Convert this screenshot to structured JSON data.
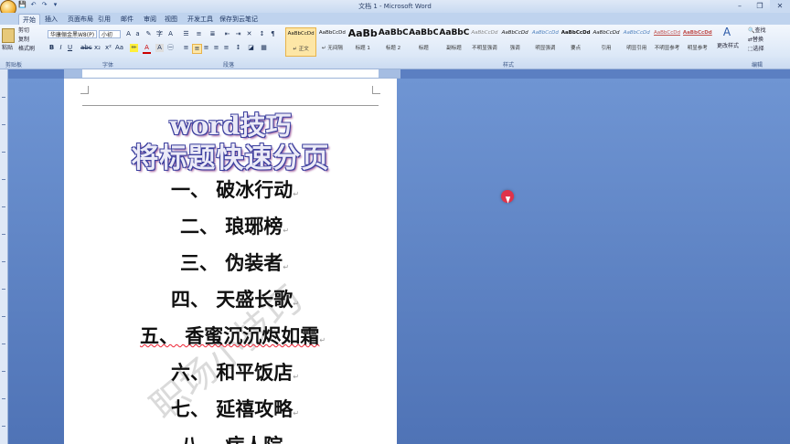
{
  "window": {
    "title": "文档 1 - Microsoft Word",
    "minimize": "–",
    "restore": "❐",
    "close": "✕"
  },
  "qat": [
    "💾",
    "↶",
    "↷",
    "▾"
  ],
  "tabs": [
    "开始",
    "插入",
    "页面布局",
    "引用",
    "邮件",
    "审阅",
    "视图",
    "开发工具",
    "保存到云笔记"
  ],
  "ribbon": {
    "clipboard": {
      "paste": "粘贴",
      "cut": "剪切",
      "copy": "复制",
      "format_painter": "格式刷",
      "label": "剪贴板"
    },
    "font": {
      "name": "华康俪金黑W8(P)",
      "size": "小初",
      "label": "字体"
    },
    "paragraph": {
      "label": "段落"
    },
    "styles": {
      "label": "样式",
      "items": [
        {
          "preview": "AaBbCcDd",
          "name": "↵ 正文"
        },
        {
          "preview": "AaBbCcDd",
          "name": "↵ 无间隔"
        },
        {
          "preview": "AaBb",
          "name": "标题 1"
        },
        {
          "preview": "AaBbC",
          "name": "标题 2"
        },
        {
          "preview": "AaBbC",
          "name": "标题"
        },
        {
          "preview": "AaBbC",
          "name": "副标题"
        },
        {
          "preview": "AaBbCcDd",
          "name": "不明显强调"
        },
        {
          "preview": "AaBbCcDd",
          "name": "强调"
        },
        {
          "preview": "AaBbCcDd",
          "name": "明显强调"
        },
        {
          "preview": "AaBbCcDd",
          "name": "要点"
        },
        {
          "preview": "AaBbCcDd",
          "name": "引用"
        },
        {
          "preview": "AaBbCcDd",
          "name": "明显引用"
        },
        {
          "preview": "AaBbCcDd",
          "name": "不明显参考"
        },
        {
          "preview": "AaBbCcDd",
          "name": "明显参考"
        }
      ],
      "change_styles": "更改样式"
    },
    "editing": {
      "find": "查找",
      "replace": "替换",
      "select": "选择",
      "label": "编辑"
    }
  },
  "document": {
    "title_line1": "word技巧",
    "title_line2": "将标题快速分页",
    "items": [
      "一、 破冰行动",
      "二、 琅琊榜",
      "三、 伪装者",
      "四、 天盛长歌",
      "五、 香蜜沉沉烬如霜",
      "六、 和平饭店",
      "七、 延禧攻略",
      "八、 病人院"
    ],
    "watermark": "职场小技巧"
  },
  "colors": {
    "accent": "#5b7fc2",
    "title_outline": "#3b3f9e",
    "cursor": "#e0334a"
  }
}
